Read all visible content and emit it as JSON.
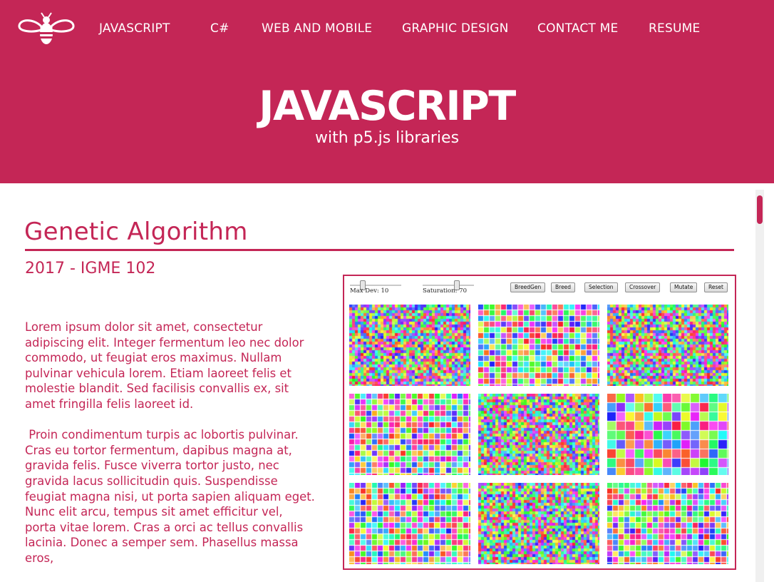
{
  "nav": {
    "items": [
      {
        "label": "JAVASCRIPT"
      },
      {
        "label": "C#"
      },
      {
        "label": "WEB AND MOBILE"
      },
      {
        "label": "GRAPHIC DESIGN"
      },
      {
        "label": "CONTACT ME"
      },
      {
        "label": "RESUME"
      }
    ]
  },
  "logo": {
    "icon": "bee-icon"
  },
  "hero": {
    "title": "JAVASCRIPT",
    "subtitle": "with p5.js libraries"
  },
  "project": {
    "title": "Genetic Algorithm",
    "subtitle": "2017 - IGME 102",
    "paragraphs": [
      "Lorem ipsum dolor sit amet, consectetur adipiscing elit. Integer fermentum leo nec dolor commodo, ut feugiat eros maximus. Nullam pulvinar vehicula lorem. Etiam laoreet felis et molestie blandit. Sed facilisis convallis ex, sit amet fringilla felis laoreet id.",
      " Proin condimentum turpis ac lobortis pulvinar. Cras eu tortor fermentum, dapibus magna at, gravida felis. Fusce viverra tortor justo, nec gravida lacus sollicitudin quis. Suspendisse feugiat magna nisi, ut porta sapien aliquam eget. Nunc elit arcu, tempus sit amet efficitur vel, porta vitae lorem. Cras a orci ac tellus convallis lacinia. Donec a semper sem. Phasellus massa eros,"
    ]
  },
  "sketch": {
    "sliders": [
      {
        "label": "Max Dev: 10",
        "value": 10
      },
      {
        "label": "Saturation: 70",
        "value": 70
      }
    ],
    "buttons": [
      {
        "label": "BreedGen"
      },
      {
        "label": "Breed"
      },
      {
        "label": "Selection"
      },
      {
        "label": "Crossover"
      },
      {
        "label": "Mutate"
      },
      {
        "label": "Reset"
      }
    ],
    "pattern_grids": [
      {
        "granularity": "fine"
      },
      {
        "granularity": "medium"
      },
      {
        "granularity": "fine"
      },
      {
        "granularity": "medium"
      },
      {
        "granularity": "fine"
      },
      {
        "granularity": "coarse"
      },
      {
        "granularity": "medium"
      },
      {
        "granularity": "fine"
      },
      {
        "granularity": "medium"
      }
    ]
  },
  "colors": {
    "brand": "#c42656",
    "background": "#ffffff"
  }
}
